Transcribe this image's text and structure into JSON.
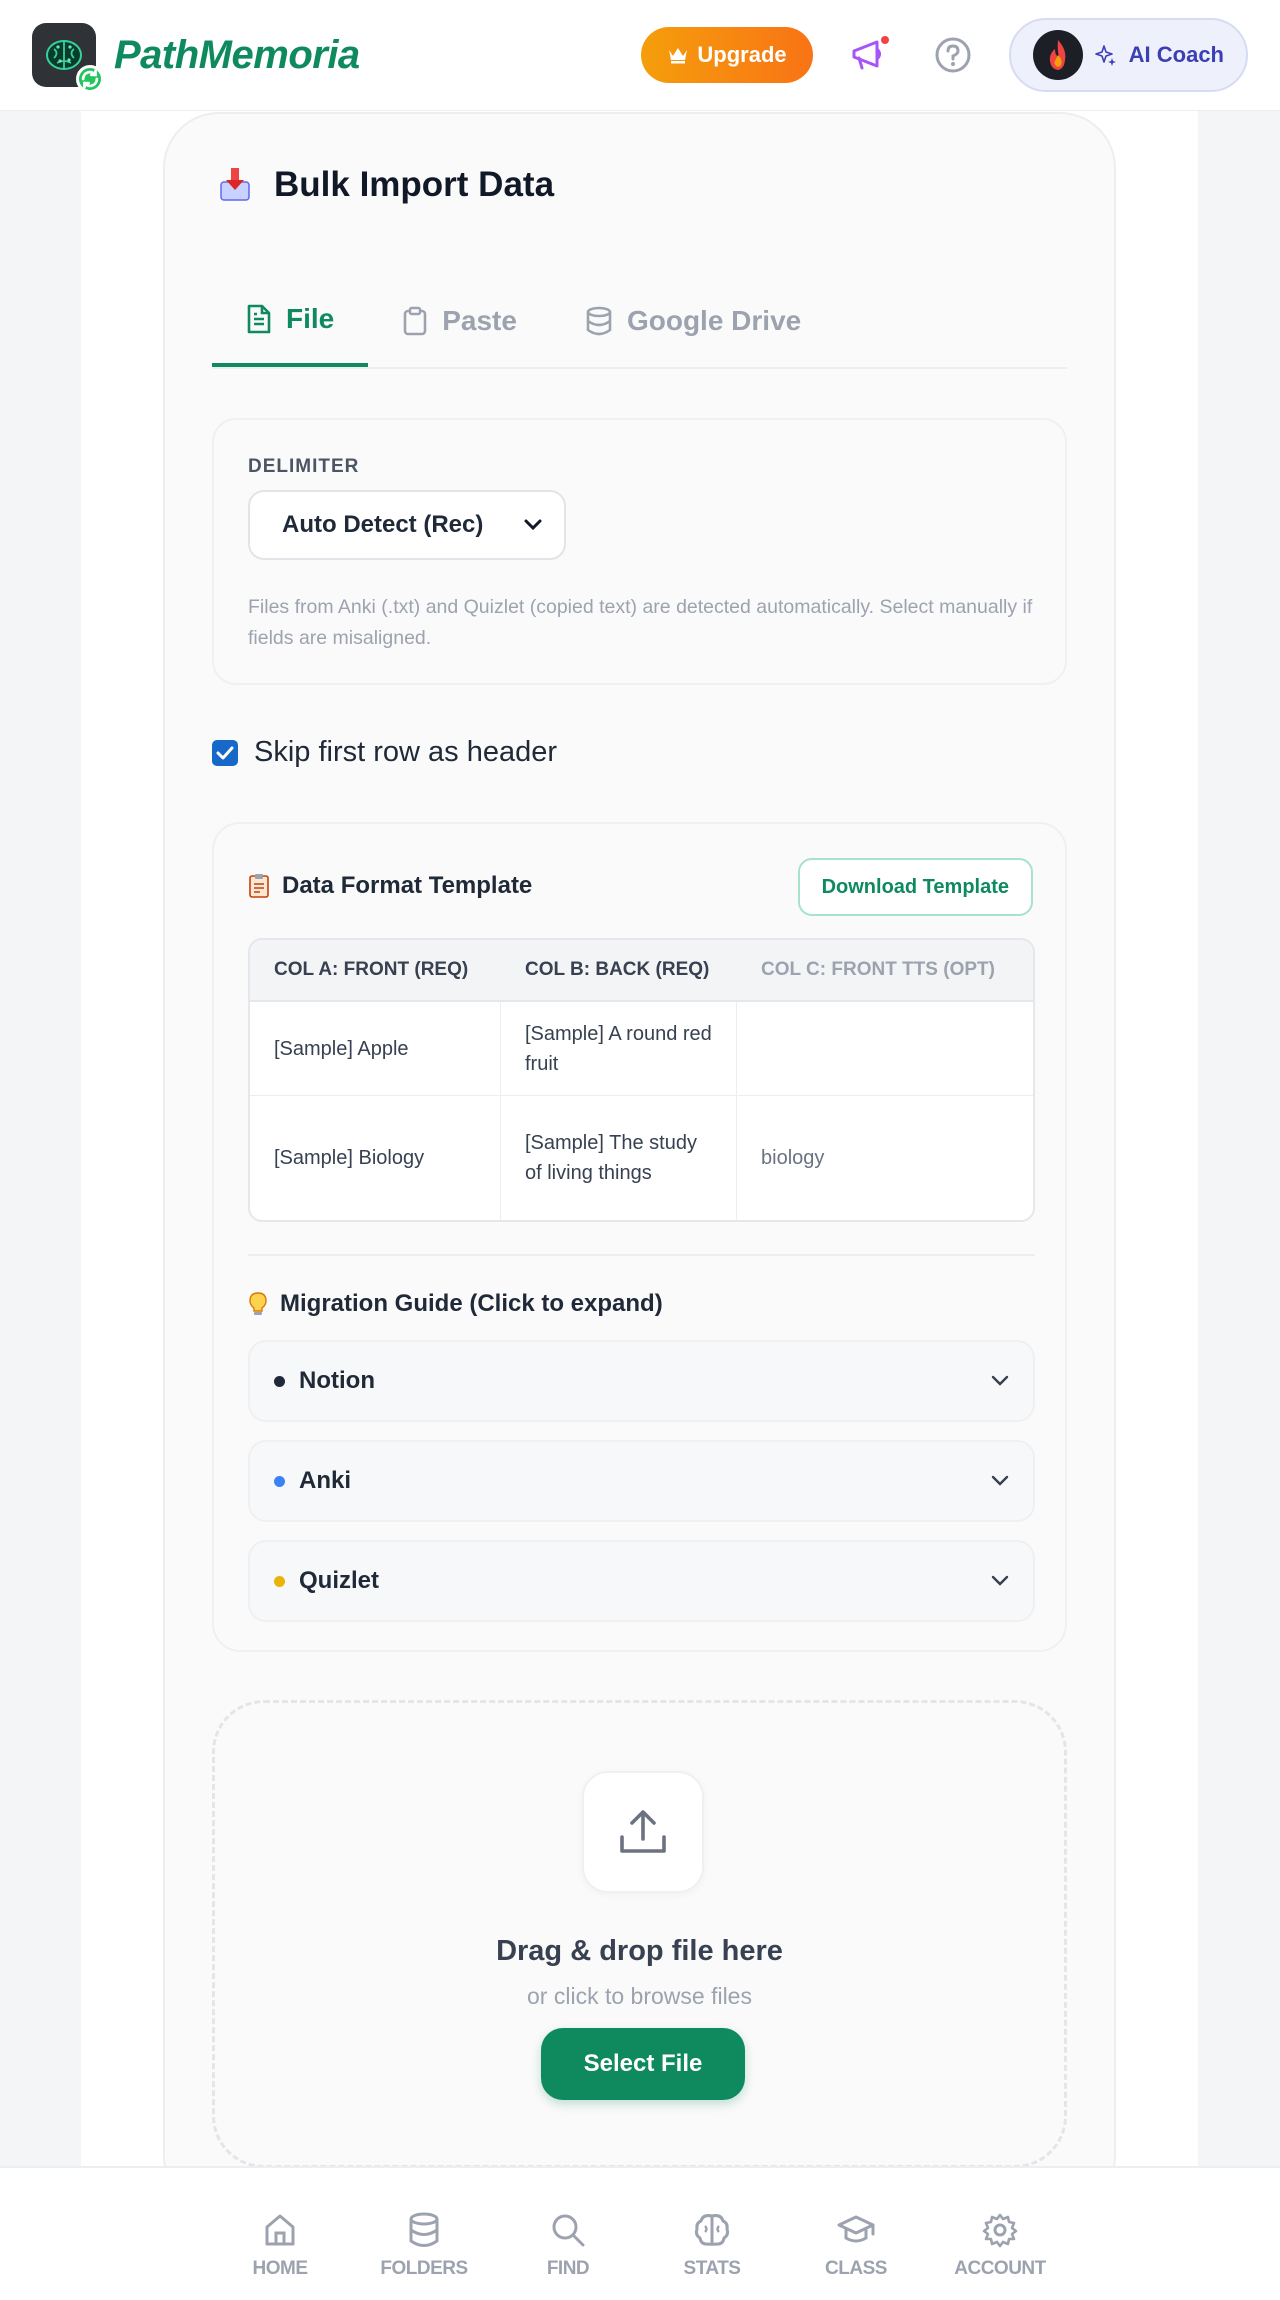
{
  "header": {
    "brand": "PathMemoria",
    "upgrade_label": "Upgrade",
    "coach_label": "AI Coach"
  },
  "card": {
    "title": "Bulk Import Data"
  },
  "tabs": [
    {
      "label": "File",
      "active": true
    },
    {
      "label": "Paste",
      "active": false
    },
    {
      "label": "Google Drive",
      "active": false
    }
  ],
  "delimiter": {
    "label": "DELIMITER",
    "selected": "Auto Detect (Rec)",
    "help": "Files from Anki (.txt) and Quizlet (copied text) are detected automatically. Select manually if fields are misaligned."
  },
  "skip_header": {
    "label": "Skip first row as header",
    "checked": true
  },
  "template": {
    "title": "Data Format Template",
    "download_label": "Download Template",
    "columns": [
      "COL A: FRONT (REQ)",
      "COL B: BACK (REQ)",
      "COL C: FRONT TTS (OPT)"
    ],
    "rows": [
      [
        "[Sample] Apple",
        "[Sample] A round red fruit",
        ""
      ],
      [
        "[Sample] Biology",
        "[Sample] The study of living things",
        "biology"
      ]
    ]
  },
  "guide": {
    "title": "Migration Guide (Click to expand)",
    "items": [
      {
        "label": "Notion",
        "color": "#1f2937"
      },
      {
        "label": "Anki",
        "color": "#3b82f6"
      },
      {
        "label": "Quizlet",
        "color": "#eab308"
      }
    ]
  },
  "dropzone": {
    "title": "Drag & drop file here",
    "subtitle": "or click to browse files",
    "button_label": "Select File"
  },
  "nav": {
    "items": [
      {
        "label": "HOME",
        "icon": "home-icon"
      },
      {
        "label": "FOLDERS",
        "icon": "database-icon"
      },
      {
        "label": "FIND",
        "icon": "search-icon"
      },
      {
        "label": "STATS",
        "icon": "brain-icon"
      },
      {
        "label": "CLASS",
        "icon": "graduation-cap-icon"
      },
      {
        "label": "ACCOUNT",
        "icon": "gear-icon"
      }
    ]
  },
  "colors": {
    "brand_green": "#0f8a5f",
    "upgrade_orange": "#f59e0b",
    "coach_indigo": "#3b3fb4",
    "checkbox_blue": "#1668c9"
  }
}
